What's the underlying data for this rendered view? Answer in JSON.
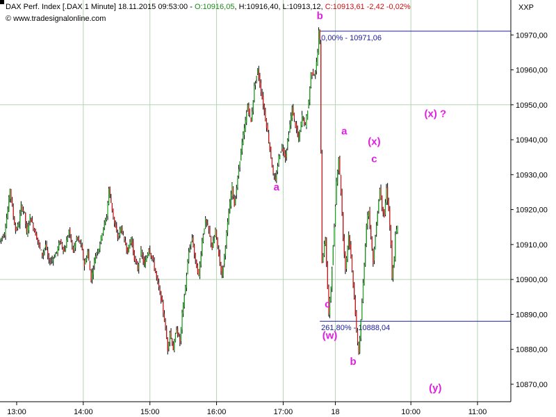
{
  "chart_data": {
    "type": "candlestick",
    "header": {
      "instrument": "DAX Perf. Index [.DAX  1 Minute]",
      "datetime": "18.11.2015 09:53:00",
      "ohlc_sep": " - ",
      "open_label": "O:",
      "open": "10916,05",
      "high_label": "H:",
      "high": "10916,40",
      "low_label": "L:",
      "low": "10913,12",
      "close_label": "C:",
      "close": "10913,61 -2,42 -0,02%"
    },
    "source": "© www.tradesignalonline.com",
    "axis_title": "XXP",
    "ylim": [
      10865,
      10980
    ],
    "yticks": [
      10870,
      10880,
      10890,
      10900,
      10910,
      10920,
      10930,
      10940,
      10950,
      10960,
      10970
    ],
    "ytick_labels": [
      "10870,00",
      "10880,00",
      "10890,00",
      "10900,00",
      "10910,00",
      "10920,00",
      "10930,00",
      "10940,00",
      "10950,00",
      "10960,00",
      "10970,00"
    ],
    "y_grid": [
      10900,
      10950
    ],
    "xticks": [
      {
        "label": "13:00",
        "x": 0
      },
      {
        "label": "14:00",
        "x": 60
      },
      {
        "label": "15:00",
        "x": 120
      },
      {
        "label": "16:00",
        "x": 180
      },
      {
        "label": "17:00",
        "x": 240
      },
      {
        "label": "18",
        "x": 287
      },
      {
        "label": "10:00",
        "x": 355
      },
      {
        "label": "11:00",
        "x": 415
      }
    ],
    "x_grid": [
      60,
      120,
      180,
      240,
      287,
      355,
      415
    ],
    "x_range": [
      -15,
      445
    ],
    "path": [
      [
        -15,
        10911
      ],
      [
        -10,
        10913
      ],
      [
        -7,
        10920
      ],
      [
        -5,
        10926
      ],
      [
        -2,
        10918
      ],
      [
        0,
        10914
      ],
      [
        3,
        10916
      ],
      [
        5,
        10921
      ],
      [
        8,
        10919
      ],
      [
        10,
        10913
      ],
      [
        13,
        10918
      ],
      [
        16,
        10915
      ],
      [
        20,
        10911
      ],
      [
        24,
        10907
      ],
      [
        27,
        10910
      ],
      [
        30,
        10905
      ],
      [
        34,
        10906
      ],
      [
        37,
        10908
      ],
      [
        40,
        10911
      ],
      [
        44,
        10908
      ],
      [
        48,
        10914
      ],
      [
        52,
        10908
      ],
      [
        55,
        10912
      ],
      [
        59,
        10910
      ],
      [
        62,
        10904
      ],
      [
        65,
        10908
      ],
      [
        68,
        10900
      ],
      [
        72,
        10907
      ],
      [
        75,
        10909
      ],
      [
        79,
        10915
      ],
      [
        82,
        10918
      ],
      [
        84,
        10926
      ],
      [
        86,
        10922
      ],
      [
        89,
        10916
      ],
      [
        92,
        10912
      ],
      [
        95,
        10915
      ],
      [
        98,
        10911
      ],
      [
        101,
        10908
      ],
      [
        104,
        10912
      ],
      [
        107,
        10906
      ],
      [
        110,
        10903
      ],
      [
        113,
        10908
      ],
      [
        116,
        10904
      ],
      [
        120,
        10909
      ],
      [
        124,
        10905
      ],
      [
        128,
        10899
      ],
      [
        132,
        10893
      ],
      [
        135,
        10886
      ],
      [
        137,
        10880
      ],
      [
        139,
        10885
      ],
      [
        142,
        10880
      ],
      [
        145,
        10886
      ],
      [
        148,
        10882
      ],
      [
        150,
        10890
      ],
      [
        153,
        10898
      ],
      [
        156,
        10908
      ],
      [
        159,
        10912
      ],
      [
        162,
        10905
      ],
      [
        165,
        10901
      ],
      [
        168,
        10911
      ],
      [
        171,
        10917
      ],
      [
        174,
        10914
      ],
      [
        177,
        10909
      ],
      [
        180,
        10914
      ],
      [
        183,
        10907
      ],
      [
        186,
        10901
      ],
      [
        189,
        10910
      ],
      [
        192,
        10919
      ],
      [
        195,
        10927
      ],
      [
        197,
        10921
      ],
      [
        200,
        10929
      ],
      [
        203,
        10937
      ],
      [
        206,
        10943
      ],
      [
        209,
        10950
      ],
      [
        212,
        10945
      ],
      [
        215,
        10955
      ],
      [
        218,
        10960
      ],
      [
        221,
        10954
      ],
      [
        224,
        10948
      ],
      [
        227,
        10942
      ],
      [
        230,
        10935
      ],
      [
        232,
        10930
      ],
      [
        234,
        10928
      ],
      [
        237,
        10935
      ],
      [
        240,
        10938
      ],
      [
        243,
        10935
      ],
      [
        246,
        10942
      ],
      [
        249,
        10949
      ],
      [
        252,
        10944
      ],
      [
        255,
        10940
      ],
      [
        258,
        10947
      ],
      [
        261,
        10944
      ],
      [
        264,
        10951
      ],
      [
        266,
        10959
      ],
      [
        270,
        10959
      ],
      [
        272,
        10965
      ],
      [
        273,
        10971
      ],
      [
        274,
        10968
      ],
      [
        276,
        10905
      ],
      [
        279,
        10912
      ],
      [
        282,
        10890
      ],
      [
        284,
        10898
      ],
      [
        287,
        10915
      ],
      [
        289,
        10928
      ],
      [
        291,
        10935
      ],
      [
        293,
        10925
      ],
      [
        295,
        10912
      ],
      [
        297,
        10903
      ],
      [
        300,
        10913
      ],
      [
        302,
        10906
      ],
      [
        305,
        10895
      ],
      [
        307,
        10885
      ],
      [
        309,
        10879
      ],
      [
        311,
        10888
      ],
      [
        314,
        10904
      ],
      [
        316,
        10916
      ],
      [
        318,
        10920
      ],
      [
        320,
        10912
      ],
      [
        322,
        10905
      ],
      [
        325,
        10916
      ],
      [
        328,
        10926
      ],
      [
        330,
        10921
      ],
      [
        332,
        10918
      ],
      [
        334,
        10926
      ],
      [
        336,
        10920
      ],
      [
        338,
        10910
      ],
      [
        339,
        10900
      ],
      [
        341,
        10906
      ],
      [
        342,
        10913
      ],
      [
        344,
        10915
      ]
    ],
    "fib_lines": [
      {
        "price": 10971.06,
        "x_start": 273,
        "x_end": 445,
        "label": "0,00% - 10971,06"
      },
      {
        "price": 10888.04,
        "x_start": 273,
        "x_end": 445,
        "label": "261,80% - 10888,04"
      }
    ],
    "annotations": [
      {
        "text": "b",
        "x": 273,
        "y": 10974.5
      },
      {
        "text": "a",
        "x": 234,
        "y": 10925.5
      },
      {
        "text": "c",
        "x": 280,
        "y": 10892
      },
      {
        "text": "(w)",
        "x": 282,
        "y": 10883
      },
      {
        "text": "a",
        "x": 295,
        "y": 10941.5
      },
      {
        "text": "b",
        "x": 303,
        "y": 10875.5
      },
      {
        "text": "(x)",
        "x": 322,
        "y": 10938.5
      },
      {
        "text": "c",
        "x": 322,
        "y": 10933.5
      },
      {
        "text": "(x) ?",
        "x": 377,
        "y": 10946.5
      },
      {
        "text": "(y)",
        "x": 377,
        "y": 10868
      }
    ]
  }
}
